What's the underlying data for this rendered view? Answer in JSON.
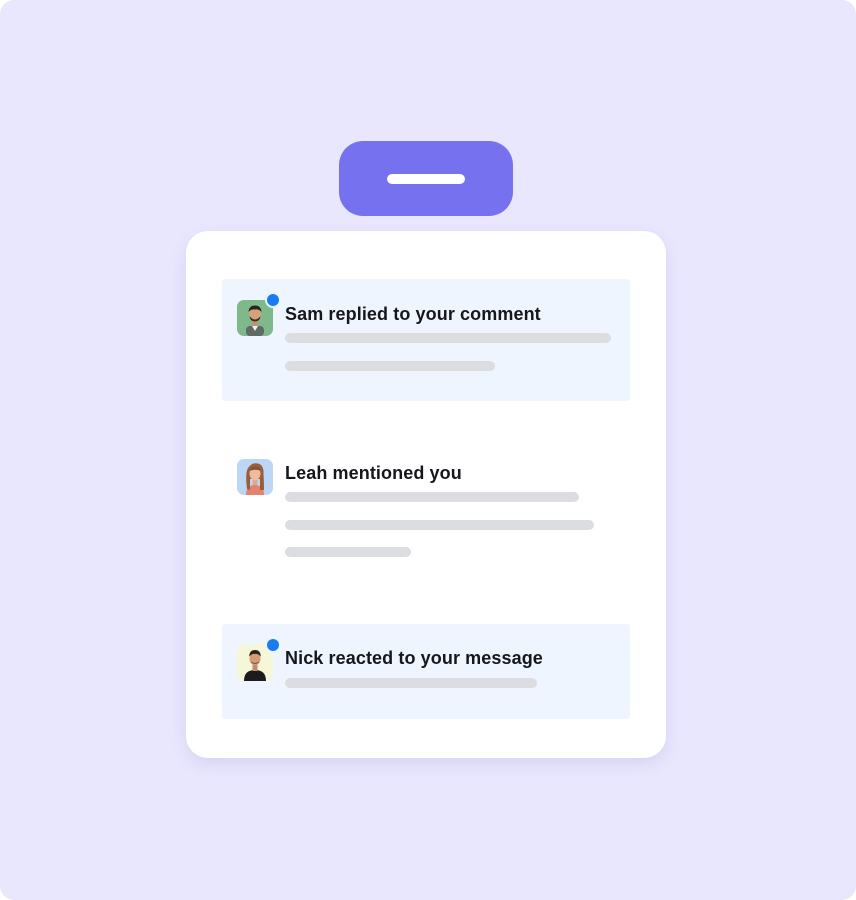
{
  "colors": {
    "background": "#e9e7fe",
    "accent": "#7672ef",
    "card": "#ffffff",
    "unread_row": "#eff5fe",
    "unread_dot": "#1a7cf2",
    "placeholder_bar": "#dcdde1"
  },
  "top_button": {
    "icon": "minus-icon"
  },
  "notifications": [
    {
      "title": "Sam replied to your comment",
      "unread": true,
      "avatar": "avatar-sam"
    },
    {
      "title": "Leah mentioned you",
      "unread": false,
      "avatar": "avatar-leah"
    },
    {
      "title": "Nick reacted to your message",
      "unread": true,
      "avatar": "avatar-nick"
    }
  ]
}
